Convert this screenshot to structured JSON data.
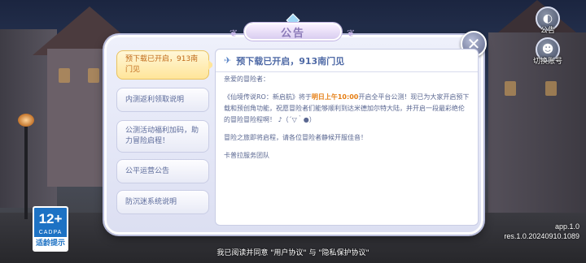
{
  "top_right": {
    "announcement_label": "公告",
    "switch_account_label": "切换账号"
  },
  "rating": {
    "age": "12+",
    "org": "CADPA",
    "tip": "适龄提示"
  },
  "version": {
    "app": "app.1.0",
    "res": "res.1.0.20240910.1089"
  },
  "agreement": {
    "prefix": "我已阅读并同意",
    "user_agreement": "\"用户协议\"",
    "and": "与",
    "privacy": "\"隐私保护协议\""
  },
  "dialog": {
    "title": "公告",
    "close_icon": "close-icon",
    "tabs": [
      {
        "label": "预下载已开启，913南门见",
        "active": true
      },
      {
        "label": "内测返利领取说明",
        "active": false
      },
      {
        "label": "公测活动福利加码，助力冒险启程！",
        "active": false
      },
      {
        "label": "公平运营公告",
        "active": false
      },
      {
        "label": "防沉迷系统说明",
        "active": false
      }
    ],
    "content": {
      "heading": "预下载已开启，913南门见",
      "greeting": "亲爱的冒险者：",
      "p1_before": "《仙境传说RO：新启航》将于",
      "p1_highlight": "明日上午10:00",
      "p1_after": "开启全平台公测！现已为大家开启预下载和预创角功能，祝愿冒险者们能够顺利到达米德加尔特大陆，并开启一段最彩绝伦的冒险冒险程啊！ ♪（´▽｀●）",
      "p2": "冒险之旅即将启程，请各位冒险者静候开服佳音！",
      "signature": "卡普拉服务团队"
    }
  },
  "colors": {
    "active_tab": "#ffe59a",
    "highlight": "#e57d12",
    "rating_blue": "#1d72c4"
  }
}
